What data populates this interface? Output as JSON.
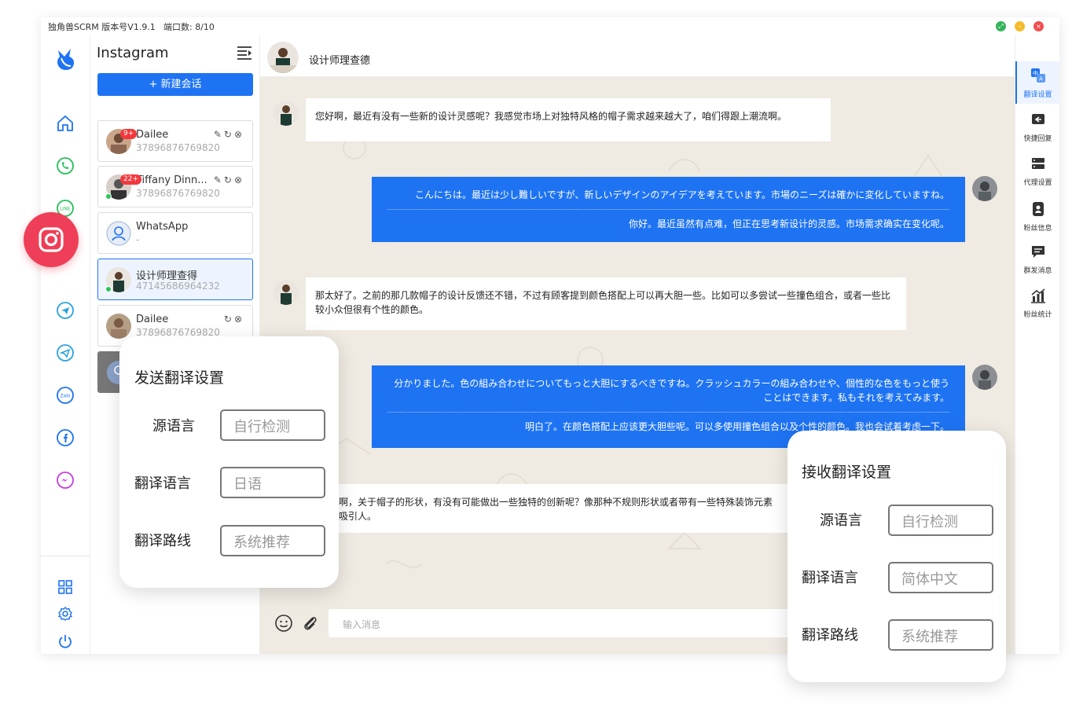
{
  "titlebar": {
    "app_title": "独角兽SCRM 版本号V1.9.1",
    "port_label": "端口数: 8/10"
  },
  "colors": {
    "accent": "#1e73f3",
    "instagram": "#ef3e57",
    "chat_bg": "#efeae2",
    "badge": "#f2383c",
    "online": "#2fc25b"
  },
  "rail": {
    "icons": [
      "unicorn-logo",
      "home-icon",
      "whatsapp-icon",
      "line-icon",
      "instagram-icon",
      "telegram-icon",
      "telegram-business-icon",
      "zalo-icon",
      "facebook-icon",
      "messenger-icon",
      "grid-icon",
      "gear-icon",
      "power-icon"
    ],
    "line_label": "LINE",
    "zalo_label": "Zalo"
  },
  "contacts": {
    "title": "Instagram",
    "new_chat_label": "+ 新建会话",
    "items": [
      {
        "name": "Dailee",
        "number": "37896876769820",
        "badge": "9+",
        "online": false
      },
      {
        "name": "Tiffany Dinn...",
        "number": "37896876769820",
        "badge": "22+",
        "online": true
      },
      {
        "name": "WhatsApp",
        "number": "-",
        "badge": "",
        "online": false
      },
      {
        "name": "设计师理查得",
        "number": "47145686964232",
        "badge": "",
        "online": true
      },
      {
        "name": "Dailee",
        "number": "37896876769820",
        "badge": "",
        "online": false
      }
    ]
  },
  "chat": {
    "contact_name": "设计师理查德",
    "messages": [
      {
        "dir": "in",
        "text": "您好啊，最近有没有一些新的设计灵感呢？我感觉市场上对独特风格的帽子需求越来越大了，咱们得跟上潮流啊。"
      },
      {
        "dir": "out",
        "text": "こんにちは。最近は少し難しいですが、新しいデザインのアイデアを考えています。市場のニーズは確かに変化していますね。",
        "translation": "你好。最近虽然有点难，但正在思考新设计的灵感。市场需求确实在变化呢。"
      },
      {
        "dir": "in",
        "text": "那太好了。之前的那几款帽子的设计反馈还不错，不过有顾客提到颜色搭配上可以再大胆一些。比如可以多尝试一些撞色组合，或者一些比较小众但很有个性的颜色。"
      },
      {
        "dir": "out",
        "text": "分かりました。色の組み合わせについてもっと大胆にするべきですね。クラッシュカラーの組み合わせや、個性的な色をもっと使うことはできます。私もそれを考えてみます。",
        "translation": "明白了。在颜色搭配上应该更大胆些呢。可以多使用撞色组合以及个性的颜色。我也会试着考虑一下。"
      },
      {
        "dir": "in",
        "text": "啊，关于帽子的形状，有没有可能做出一些独特的创新呢？像那种不规则形状或者带有一些特殊装饰元素",
        "text2": "吸引人。"
      }
    ],
    "input_placeholder": "输入消息"
  },
  "tools": [
    {
      "label": "翻译设置",
      "active": true
    },
    {
      "label": "快捷回复",
      "active": false
    },
    {
      "label": "代理设置",
      "active": false
    },
    {
      "label": "粉丝信息",
      "active": false
    },
    {
      "label": "群发消息",
      "active": false
    },
    {
      "label": "粉丝统计",
      "active": false
    }
  ],
  "send_translation": {
    "title": "发送翻译设置",
    "source_label": "源语言",
    "source_value": "自行检测",
    "target_label": "翻译语言",
    "target_value": "日语",
    "route_label": "翻译路线",
    "route_value": "系统推荐"
  },
  "receive_translation": {
    "title": "接收翻译设置",
    "source_label": "源语言",
    "source_value": "自行检测",
    "target_label": "翻译语言",
    "target_value": "简体中文",
    "route_label": "翻译路线",
    "route_value": "系统推荐"
  }
}
